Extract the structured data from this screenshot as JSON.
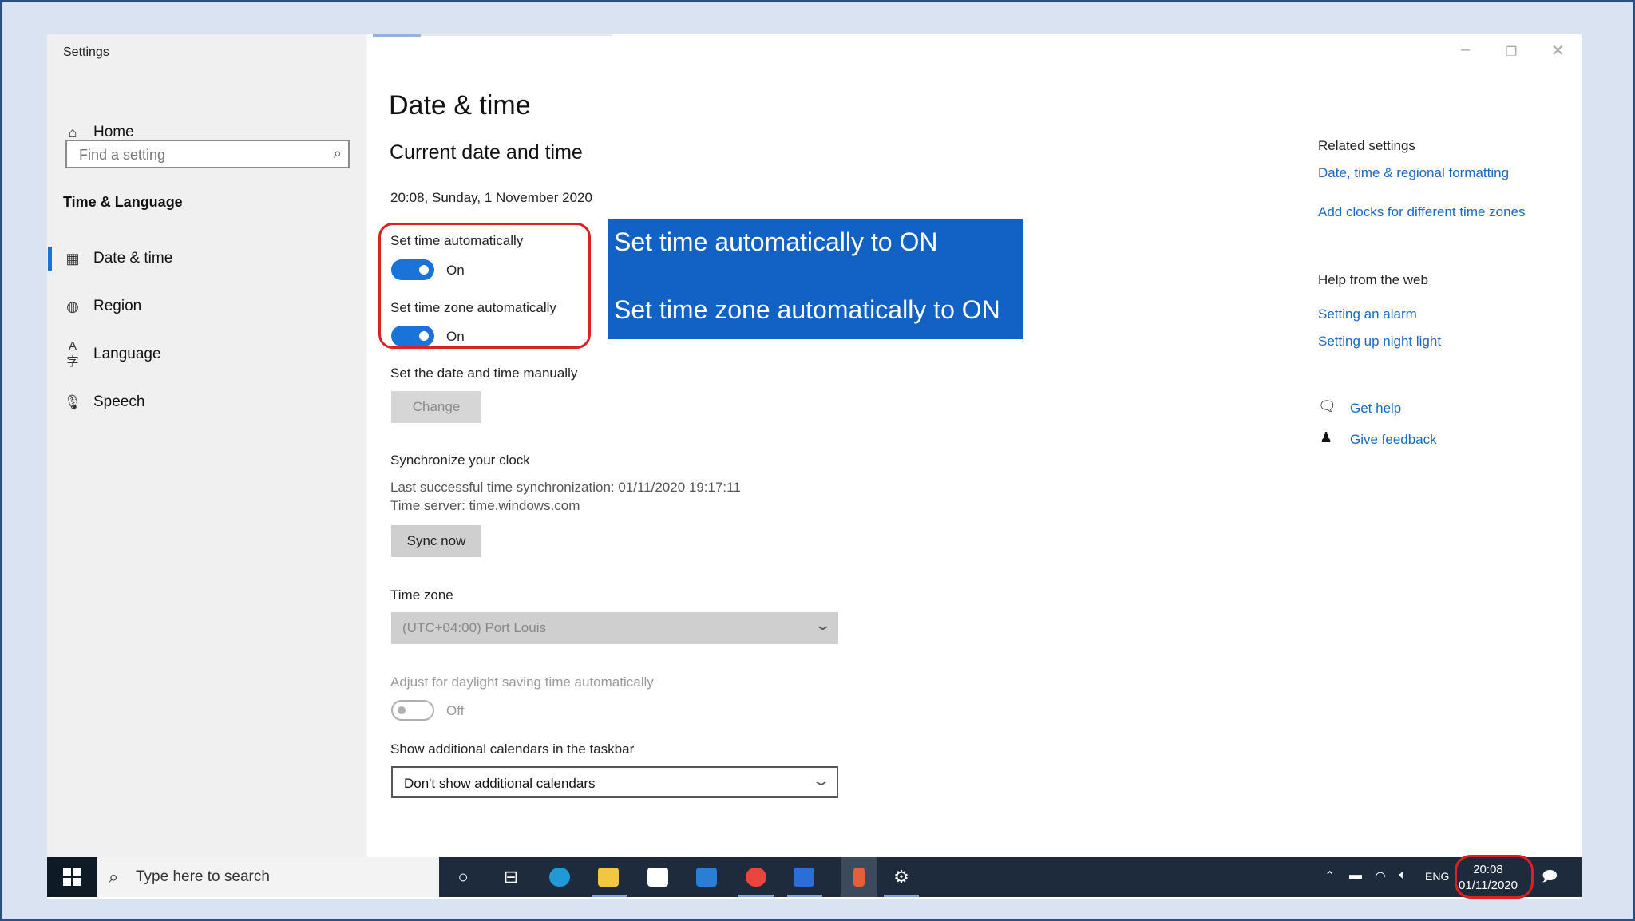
{
  "window": {
    "title": "Settings"
  },
  "sidebar": {
    "home_label": "Home",
    "search_placeholder": "Find a setting",
    "section_label": "Time & Language",
    "items": [
      {
        "label": "Date & time",
        "icon": "calendar-clock-icon",
        "active": true
      },
      {
        "label": "Region",
        "icon": "globe-icon"
      },
      {
        "label": "Language",
        "icon": "language-icon"
      },
      {
        "label": "Speech",
        "icon": "microphone-icon"
      }
    ]
  },
  "main": {
    "page_title": "Date & time",
    "section_title": "Current date and time",
    "current_datetime": "20:08, Sunday, 1 November 2020",
    "set_time_auto": {
      "label": "Set time automatically",
      "state": "On"
    },
    "set_timezone_auto": {
      "label": "Set time zone automatically",
      "state": "On"
    },
    "manual": {
      "label": "Set the date and time manually",
      "button": "Change"
    },
    "sync": {
      "title": "Synchronize your clock",
      "last_sync": "Last successful time synchronization: 01/11/2020 19:17:11",
      "server": "Time server: time.windows.com",
      "button": "Sync now"
    },
    "timezone": {
      "label": "Time zone",
      "value": "(UTC+04:00) Port Louis"
    },
    "dst": {
      "label": "Adjust for daylight saving time automatically",
      "state": "Off"
    },
    "calendars": {
      "label": "Show additional calendars in the taskbar",
      "value": "Don't show additional calendars"
    }
  },
  "annotation": {
    "line1": "Set time automatically to ON",
    "line2": "Set time zone automatically to ON",
    "highlight_color": "#e02020",
    "callout_color": "#1162c4"
  },
  "related": {
    "title": "Related settings",
    "links": [
      "Date, time & regional formatting",
      "Add clocks for different time zones"
    ],
    "help_title": "Help from the web",
    "help_links": [
      "Setting an alarm",
      "Setting up night light"
    ],
    "get_help": "Get help",
    "give_feedback": "Give feedback"
  },
  "taskbar": {
    "search_text": "Type here to search",
    "language": "ENG",
    "time": "20:08",
    "date": "01/11/2020"
  },
  "colors": {
    "accent": "#1a73d9",
    "link": "#1a68c0",
    "sidebar_bg": "#f0f0f0",
    "taskbar_bg": "#1e2b3c"
  }
}
